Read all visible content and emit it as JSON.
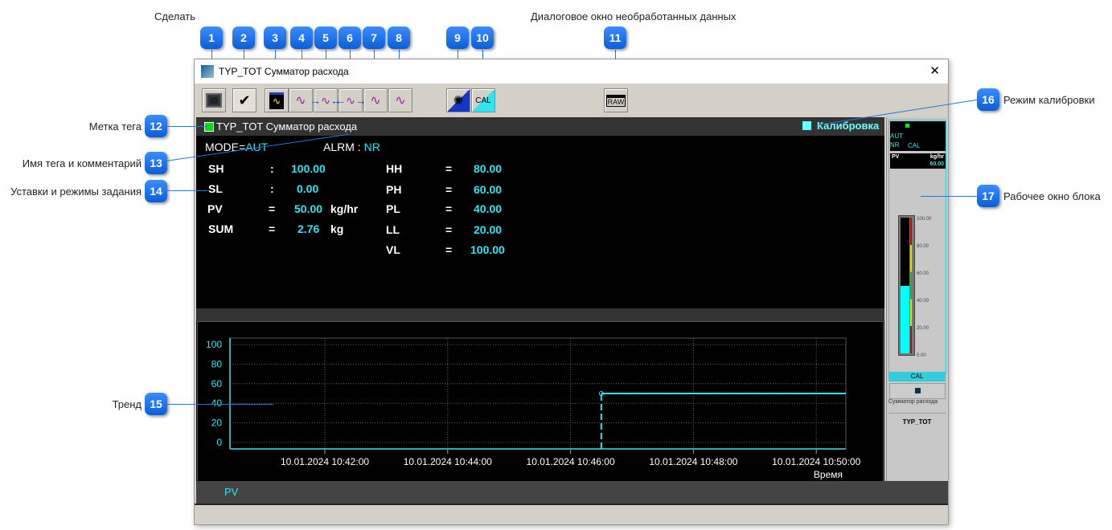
{
  "callouts": {
    "top_label_first": "Сделать",
    "top_label_last": "Диалоговое окно необработанных данных",
    "badges": [
      "1",
      "2",
      "3",
      "4",
      "5",
      "6",
      "7",
      "8",
      "9",
      "10",
      "11",
      "12",
      "13",
      "14",
      "15",
      "16",
      "17"
    ],
    "tag_mark": "Метка тега",
    "tag_name": "Имя тега и комментарий",
    "setpoints": "Уставки и режимы задания",
    "trend": "Тренд",
    "cal_mode": "Режим калибровки",
    "block_window": "Рабочее окно блока"
  },
  "window": {
    "title": "TYP_TOT Сумматор расхода",
    "close": "✕"
  },
  "toolbar": {
    "cal": "CAL",
    "raw": "RAW"
  },
  "faceplate": {
    "tag": "TYP_TOT Сумматор расхода",
    "calibration": "Калибровка",
    "mode_label": "MODE=",
    "mode": "AUT",
    "alrm_label": "ALRM : ",
    "alrm": "NR",
    "left": [
      {
        "name": "SH",
        "sep": ":",
        "value": "100.00",
        "unit": ""
      },
      {
        "name": "SL",
        "sep": ":",
        "value": "0.00",
        "unit": ""
      },
      {
        "name": "PV",
        "sep": "=",
        "value": "50.00",
        "unit": "kg/hr"
      },
      {
        "name": "SUM",
        "sep": "=",
        "value": "2.76",
        "unit": "kg"
      }
    ],
    "right": [
      {
        "name": "HH",
        "sep": "=",
        "value": "80.00"
      },
      {
        "name": "PH",
        "sep": "=",
        "value": "60.00"
      },
      {
        "name": "PL",
        "sep": "=",
        "value": "40.00"
      },
      {
        "name": "LL",
        "sep": "=",
        "value": "20.00"
      },
      {
        "name": "VL",
        "sep": "=",
        "value": "100.00"
      }
    ]
  },
  "chart_data": {
    "type": "line",
    "xlabel": "Время",
    "yticks": [
      "100",
      "80",
      "60",
      "40",
      "20",
      "0"
    ],
    "xticks": [
      "10.01.2024 10:42:00",
      "10.01.2024 10:44:00",
      "10.01.2024 10:46:00",
      "10.01.2024 10:48:00",
      "10.01.2024 10:50:00"
    ],
    "ylim": [
      0,
      100
    ],
    "series": [
      {
        "name": "PV",
        "color": "#2ee6f0",
        "points": [
          [
            "10:46:30",
            0
          ],
          [
            "10:46:30",
            50
          ],
          [
            "10:50:30",
            50
          ]
        ]
      }
    ],
    "grid": true,
    "legend": "PV"
  },
  "block": {
    "mode": "AUT",
    "alarm": "NR",
    "cal": "CAL",
    "pv_label": "PV",
    "unit": "kg/hr",
    "pv": "60.00",
    "scale": [
      "100.00",
      "80.00",
      "60.00",
      "40.00",
      "20.00",
      "0.00"
    ],
    "bar_fill_percent": 50,
    "cal_bar": "CAL",
    "comment": "Сумматор расхода",
    "tag": "TYP_TOT"
  },
  "colors": {
    "accent": "#2ee6f0",
    "tag_ok": "#00e000",
    "callout": "#1e78e6"
  }
}
